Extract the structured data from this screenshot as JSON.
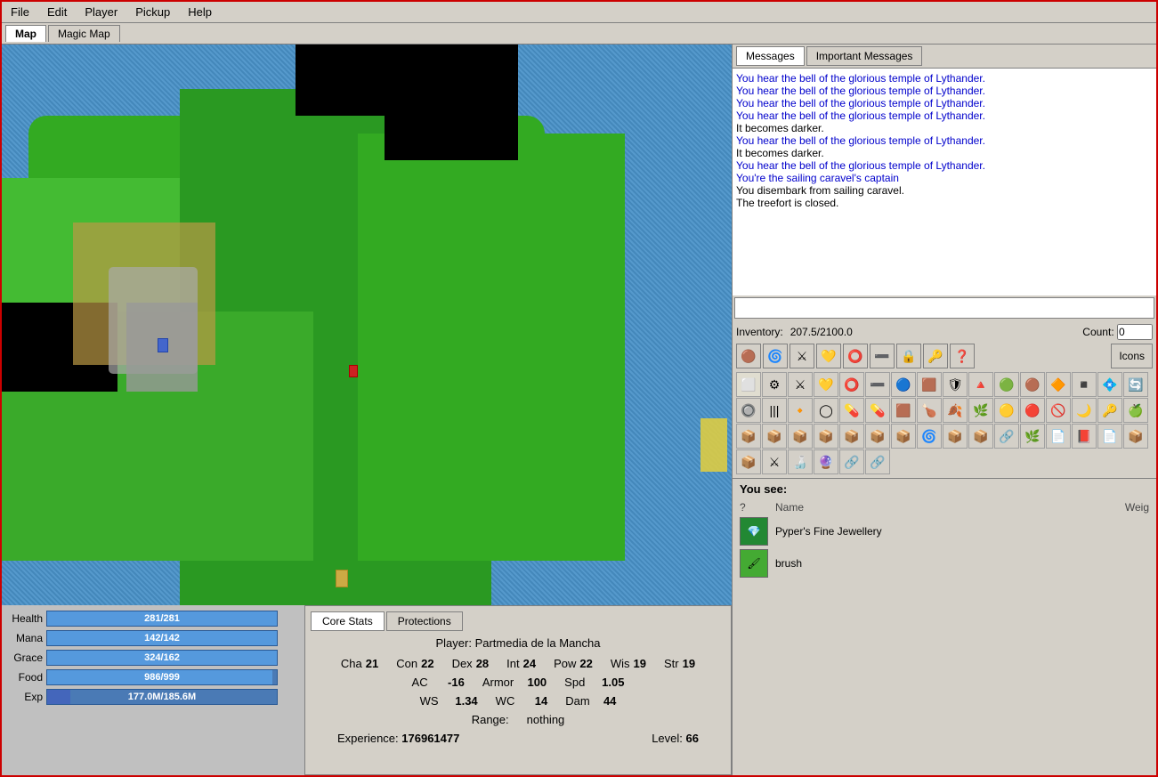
{
  "menubar": {
    "items": [
      "File",
      "Edit",
      "Player",
      "Pickup",
      "Help"
    ]
  },
  "map_tabs": [
    {
      "label": "Map",
      "active": true
    },
    {
      "label": "Magic Map",
      "active": false
    }
  ],
  "messages": {
    "tabs": [
      {
        "label": "Messages",
        "active": true
      },
      {
        "label": "Important Messages",
        "active": false
      }
    ],
    "lines": [
      {
        "text": "You hear the bell of the glorious temple of Lythander.",
        "color": "blue"
      },
      {
        "text": "You hear the bell of the glorious temple of Lythander.",
        "color": "blue"
      },
      {
        "text": "You hear the bell of the glorious temple of Lythander.",
        "color": "blue"
      },
      {
        "text": "You hear the bell of the glorious temple of Lythander.",
        "color": "blue"
      },
      {
        "text": "It becomes darker.",
        "color": "black"
      },
      {
        "text": "You hear the bell of the glorious temple of Lythander.",
        "color": "blue"
      },
      {
        "text": "It becomes darker.",
        "color": "black"
      },
      {
        "text": "You hear the bell of the glorious temple of Lythander.",
        "color": "blue"
      },
      {
        "text": "You're the sailing caravel's captain",
        "color": "blue"
      },
      {
        "text": "You disembark from sailing caravel.",
        "color": "black"
      },
      {
        "text": "The treefort is closed.",
        "color": "black"
      }
    ]
  },
  "inventory": {
    "label": "Inventory:",
    "weight": "207.5/2100.0",
    "count_label": "Count:",
    "count_value": "0",
    "icons_label": "Icons"
  },
  "you_see": {
    "label": "You see:",
    "columns": [
      "?",
      "Name",
      "Weig"
    ],
    "items": [
      {
        "name": "Pyper's Fine Jewellery",
        "icon": "💎",
        "icon_bg": "#228833"
      },
      {
        "name": "brush",
        "icon": "🖌",
        "icon_bg": "#44aa33"
      }
    ]
  },
  "stats": {
    "health_label": "Health",
    "health_value": "281/281",
    "health_pct": 100,
    "mana_label": "Mana",
    "mana_value": "142/142",
    "mana_pct": 100,
    "grace_label": "Grace",
    "grace_value": "324/162",
    "grace_pct": 100,
    "food_label": "Food",
    "food_value": "986/999",
    "food_pct": 98,
    "exp_label": "Exp",
    "exp_value": "177.0M/185.6M",
    "exp_pct": 95
  },
  "char_tabs": [
    {
      "label": "Core Stats",
      "active": true
    },
    {
      "label": "Protections",
      "active": false
    }
  ],
  "char_stats": {
    "player_label": "Player:",
    "player_name": "Partmedia de la Mancha",
    "attributes": [
      {
        "key": "Cha",
        "val": "21"
      },
      {
        "key": "Con",
        "val": "22"
      },
      {
        "key": "Dex",
        "val": "28"
      },
      {
        "key": "Int",
        "val": "24"
      },
      {
        "key": "Pow",
        "val": "22"
      },
      {
        "key": "Wis",
        "val": "19"
      },
      {
        "key": "Str",
        "val": "19"
      }
    ],
    "ac_label": "AC",
    "ac_val": "-16",
    "armor_label": "Armor",
    "armor_val": "100",
    "spd_label": "Spd",
    "spd_val": "1.05",
    "ws_label": "WS",
    "ws_val": "1.34",
    "wc_label": "WC",
    "wc_val": "14",
    "dam_label": "Dam",
    "dam_val": "44",
    "range_label": "Range:",
    "range_val": "nothing",
    "exp_label": "Experience:",
    "exp_val": "176961477",
    "level_label": "Level:",
    "level_val": "66"
  }
}
